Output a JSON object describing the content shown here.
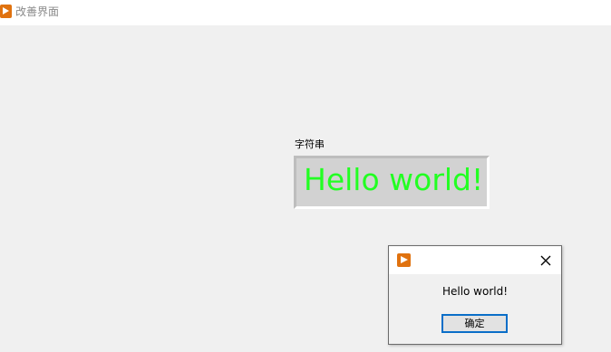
{
  "window": {
    "title": "改善界面",
    "icon": "app-play-icon",
    "icon_color": "#e0720f"
  },
  "control": {
    "label": "字符串",
    "value": "Hello world!",
    "value_color": "#22ff22"
  },
  "dialog": {
    "icon": "app-play-icon",
    "close_icon": "close-icon",
    "message": "Hello world!",
    "ok_label": "确定",
    "accent": "#0a6ec8"
  }
}
